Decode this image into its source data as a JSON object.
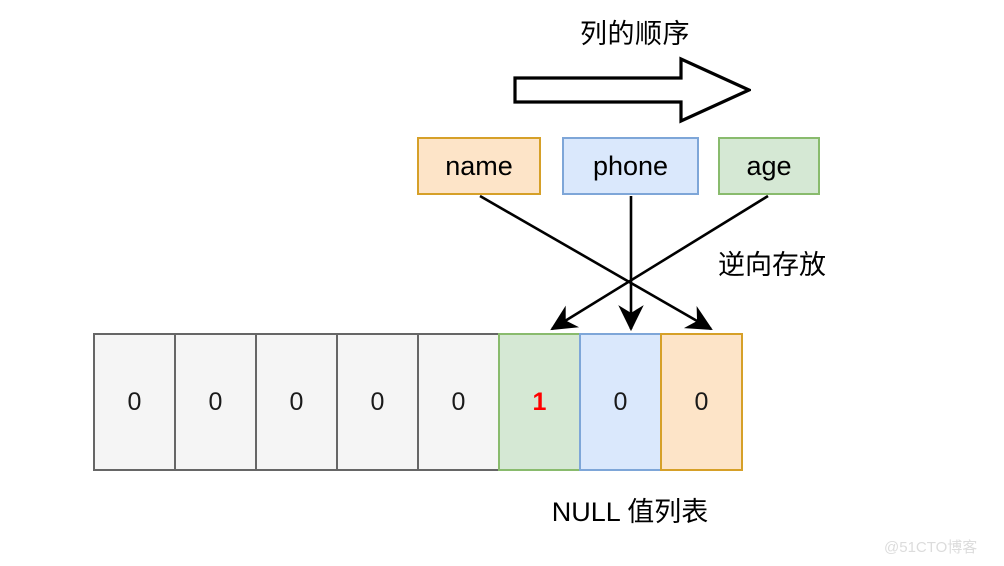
{
  "diagram": {
    "order_title": "列的顺序",
    "reverse_note": "逆向存放",
    "null_caption": "NULL 值列表",
    "watermark": "@51CTO博客",
    "arrow_icon": "right-block-arrow",
    "columns": [
      {
        "label": "name",
        "fill": "#fde4c8",
        "border": "#d6a028"
      },
      {
        "label": "phone",
        "fill": "#dae8fc",
        "border": "#7ea6d8"
      },
      {
        "label": "age",
        "fill": "#d5e8d4",
        "border": "#89bb6d"
      }
    ],
    "null_bitmap": [
      {
        "value": "0",
        "style": "grey",
        "flag": false
      },
      {
        "value": "0",
        "style": "grey",
        "flag": false
      },
      {
        "value": "0",
        "style": "grey",
        "flag": false
      },
      {
        "value": "0",
        "style": "grey",
        "flag": false
      },
      {
        "value": "0",
        "style": "grey",
        "flag": false
      },
      {
        "value": "1",
        "style": "green",
        "flag": true
      },
      {
        "value": "0",
        "style": "blue",
        "flag": false
      },
      {
        "value": "0",
        "style": "orange",
        "flag": false
      }
    ],
    "mappings": [
      {
        "from": "name",
        "to_cell_index": 7,
        "arrow": "diagonal-right-down"
      },
      {
        "from": "phone",
        "to_cell_index": 6,
        "arrow": "straight-down"
      },
      {
        "from": "age",
        "to_cell_index": 5,
        "arrow": "diagonal-left-down"
      }
    ],
    "colors": {
      "flag_red": "#ff0000",
      "line": "#000000",
      "grey_fill": "#f5f5f5",
      "grey_border": "#666666"
    }
  }
}
